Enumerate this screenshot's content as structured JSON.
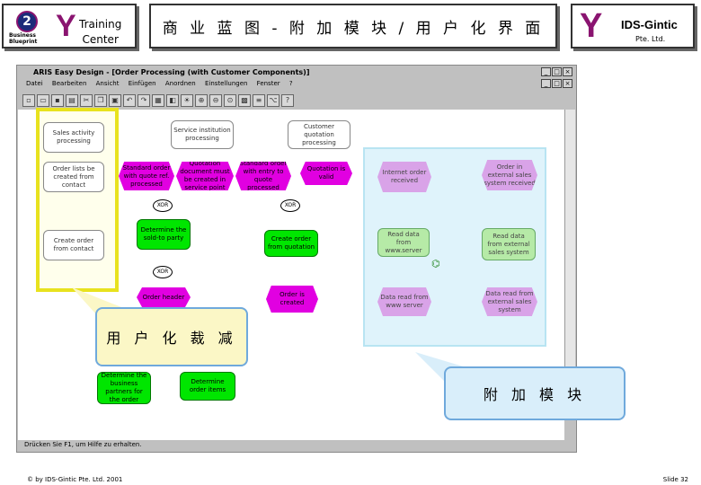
{
  "header": {
    "training_center": "Training\nCenter",
    "slide_title": "商 业 蓝 图 -  附 加 模 块 / 用 户 化 界 面",
    "ids_name": "IDS-Gintic",
    "ids_sub": "Pte. Ltd.",
    "business_blueprint_label": "Business\nBlueprint"
  },
  "app": {
    "title": "ARIS Easy Design - [Order Processing (with Customer Components)]",
    "menu": [
      "Datei",
      "Bearbeiten",
      "Ansicht",
      "Einfügen",
      "Anordnen",
      "Einstellungen",
      "Fenster",
      "?"
    ],
    "status_text": "Drücken Sie F1, um Hilfe zu erhalten.",
    "window_buttons": [
      "_",
      "□",
      "×"
    ]
  },
  "diagram": {
    "nodes_left": [
      "Sales activity processing",
      "Order lists be created from contact",
      "Create order from contact"
    ],
    "nodes_top": [
      "Standard order with quote ref. processed",
      "Quotation document must be created in service point",
      "Standard order with entry to quote processed",
      "Quotation is valid"
    ],
    "nodes_top_white": [
      "Service institution processing",
      "Customer quotation processing"
    ],
    "nodes_mid": [
      "Determine the sold-to party",
      "Create order from quotation"
    ],
    "nodes_bottom": [
      "Order header",
      "Order is created"
    ],
    "nodes_low": [
      "Determine the business partners for the order",
      "Determine order items"
    ],
    "cyan_nodes": [
      "Internet order received",
      "Order in external sales system received",
      "Read data from www.server",
      "Read data from external sales system",
      "Data read from www server",
      "Data read from external sales system"
    ],
    "connectors": [
      "XOR",
      "XOR",
      "XOR"
    ]
  },
  "callouts": {
    "customization": "用 户 化 裁 减",
    "addon_module": "附 加 模 块"
  },
  "footer": {
    "copyright": "© by IDS-Gintic Pte. Ltd. 2001",
    "slide_no": "Slide 32"
  },
  "colors": {
    "function": "#00e600",
    "event": "#e100e1",
    "highlight_yellow": "#e8e21e",
    "cyan_box": "#dff3fb"
  }
}
